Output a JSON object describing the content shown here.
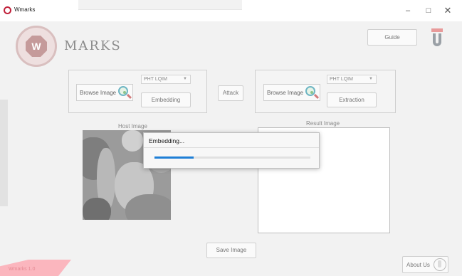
{
  "window": {
    "title": "Wmarks",
    "minimize": "–",
    "maximize": "□",
    "close": "✕"
  },
  "header": {
    "logo_letter": "W",
    "brand": "MARKS",
    "guide_label": "Guide"
  },
  "embed_panel": {
    "browse_label": "Browse Image",
    "method_selected": "PHT LQIM",
    "action_label": "Embedding"
  },
  "attack_label": "Attack",
  "extract_panel": {
    "browse_label": "Browse Image",
    "method_selected": "PHT LQIM",
    "action_label": "Extraction"
  },
  "host_image_label": "Host Image",
  "result_image_label": "Result Image",
  "dialog": {
    "title": "Embedding...",
    "progress_fraction": 0.25
  },
  "save_label": "Save Image",
  "about_label": "About Us",
  "version": "Wmarks 1.0",
  "colors": {
    "accent": "#c0203a",
    "progress": "#1f7fd6",
    "corner": "#fbb6be"
  }
}
